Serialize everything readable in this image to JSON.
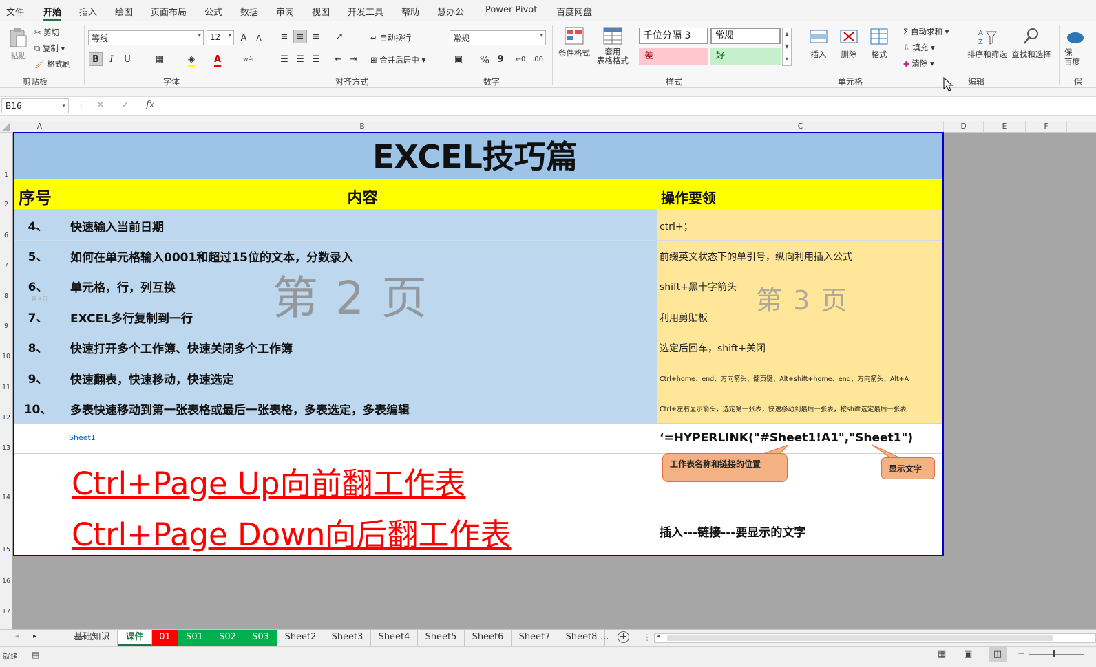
{
  "menu": {
    "tabs": [
      "文件",
      "开始",
      "插入",
      "绘图",
      "页面布局",
      "公式",
      "数据",
      "审阅",
      "视图",
      "开发工具",
      "帮助",
      "慧办公",
      "Power Pivot",
      "百度网盘"
    ],
    "active": "开始"
  },
  "ribbon": {
    "clipboard": {
      "paste": "粘贴",
      "cut": "剪切",
      "copy": "复制",
      "format_painter": "格式刷",
      "label": "剪贴板"
    },
    "font": {
      "name": "等线",
      "size": "12",
      "bold": "B",
      "italic": "I",
      "underline": "U",
      "label": "字体",
      "grow": "A",
      "shrink": "A",
      "font_color": "A",
      "phonetic": "wén"
    },
    "alignment": {
      "wrap": "自动换行",
      "merge": "合并后居中",
      "label": "对齐方式"
    },
    "number": {
      "format": "常规",
      "percent": "%",
      "comma": "9",
      "label": "数字"
    },
    "styles": {
      "cond_format": "条件格式",
      "table_format_1": "套用",
      "table_format_2": "表格格式",
      "thousands": "千位分隔 3",
      "normal": "常规",
      "bad": "差",
      "good": "好",
      "label": "样式"
    },
    "cells": {
      "insert": "插入",
      "delete": "删除",
      "format": "格式",
      "label": "单元格"
    },
    "editing": {
      "autosum": "自动求和",
      "fill": "填充",
      "clear": "清除",
      "sort_filter": "排序和筛选",
      "find_select": "查找和选择",
      "label": "编辑"
    },
    "extra": {
      "save_1": "保",
      "save_2": "百度",
      "cut_label": "保"
    }
  },
  "formula_bar": {
    "name_box": "B16",
    "cancel": "✕",
    "enter": "✓",
    "fx": "fx",
    "formula": ""
  },
  "columns": [
    "A",
    "B",
    "C",
    "D",
    "E",
    "F"
  ],
  "rows": [
    "1",
    "2",
    "6",
    "7",
    "8",
    "9",
    "10",
    "11",
    "12",
    "13",
    "14",
    "15",
    "16",
    "17"
  ],
  "sheet": {
    "title": "EXCEL技巧篇",
    "header": {
      "no": "序号",
      "content": "内容",
      "key": "操作要领"
    },
    "items": [
      {
        "no": "4、",
        "content": "快速输入当前日期",
        "key": "ctrl+；"
      },
      {
        "no": "5、",
        "content": "如何在单元格输入0001和超过15位的文本，分数录入",
        "key": "前缀英文状态下的单引号，纵向利用插入公式"
      },
      {
        "no": "6、",
        "content": "单元格，行，列互换",
        "key": "shift+黑十字箭头"
      },
      {
        "no": "7、",
        "content": "EXCEL多行复制到一行",
        "key": "利用剪贴板"
      },
      {
        "no": "8、",
        "content": "快速打开多个工作簿、快速关闭多个工作簿",
        "key": "选定后回车，shift+关闭"
      },
      {
        "no": "9、",
        "content": "快速翻表，快速移动，快速选定",
        "key": "Ctrl+home、end、方向箭头、翻页键、Alt+shift+home、end、方向箭头、Alt+A"
      },
      {
        "no": "10、",
        "content": "多表快速移动到第一张表格或最后一张表格，多表选定，多表编辑",
        "key": "Ctrl+左右显示箭头，选定第一张表，快速移动到最后一张表，按shift选定最后一张表"
      }
    ],
    "page2": "第 2 页",
    "page3": "第 3 页",
    "row8_small": "第 4 页",
    "link": "Sheet1",
    "formula_text": "‘=HYPERLINK(\"#Sheet1!A1\",\"Sheet1\")",
    "callout_1": "工作表名称和链接的位置",
    "callout_2": "显示文字",
    "ctrl_up": "Ctrl+Page Up向前翻工作表",
    "ctrl_down": "Ctrl+Page Down向后翻工作表",
    "insert_tip": "插入---链接---要显示的文字"
  },
  "sheet_tabs": [
    {
      "name": "基础知识",
      "style": "normal"
    },
    {
      "name": "课件",
      "style": "active"
    },
    {
      "name": "01",
      "style": "red"
    },
    {
      "name": "S01",
      "style": "green"
    },
    {
      "name": "S02",
      "style": "green"
    },
    {
      "name": "S03",
      "style": "green"
    },
    {
      "name": "Sheet2",
      "style": "normal"
    },
    {
      "name": "Sheet3",
      "style": "normal"
    },
    {
      "name": "Sheet4",
      "style": "normal"
    },
    {
      "name": "Sheet5",
      "style": "normal"
    },
    {
      "name": "Sheet6",
      "style": "normal"
    },
    {
      "name": "Sheet7",
      "style": "normal"
    },
    {
      "name": "Sheet8",
      "style": "normal"
    }
  ],
  "tabs_more": "...",
  "status": {
    "ready": "就绪"
  },
  "colors": {
    "accent": "#217346",
    "title_bg": "#9dc3e6",
    "header_bg": "#ffff00",
    "content_bg": "#bdd7ee",
    "key_bg": "#ffe699",
    "border_blue": "#0000cc",
    "red_text": "#ff0000"
  }
}
